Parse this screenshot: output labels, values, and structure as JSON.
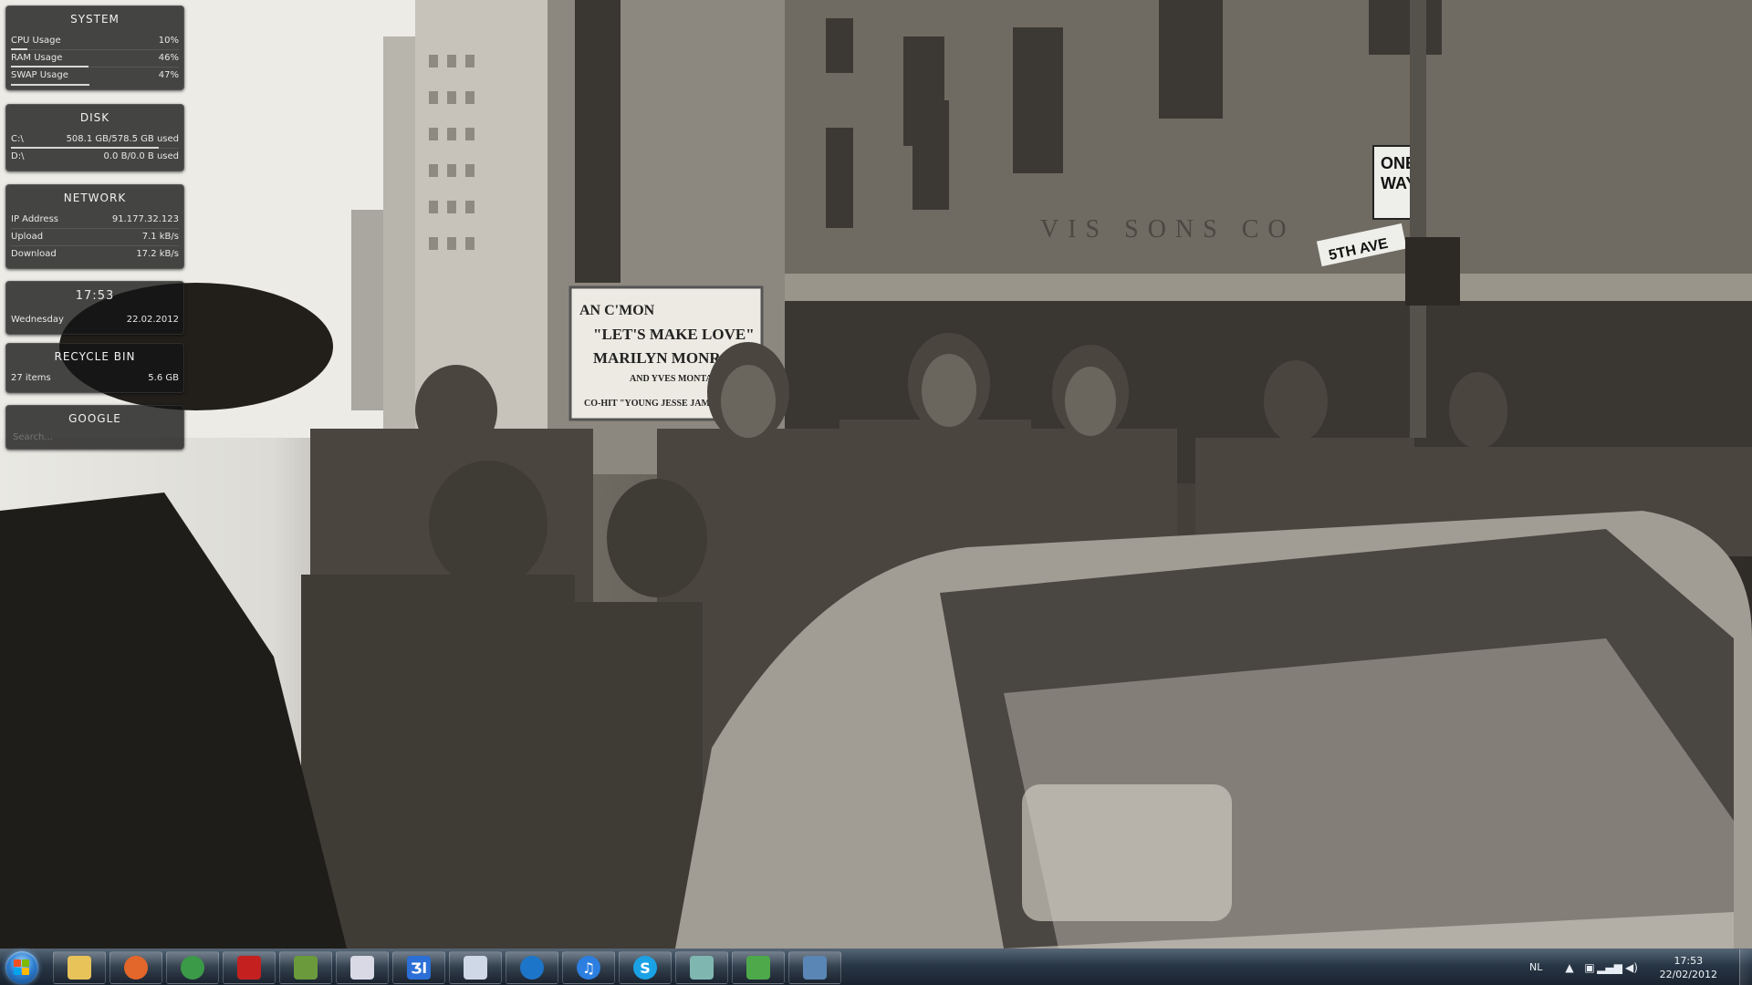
{
  "gadgets": {
    "system": {
      "title": "SYSTEM",
      "rows": [
        {
          "label": "CPU Usage",
          "value": "10%",
          "level": 0.1
        },
        {
          "label": "RAM Usage",
          "value": "46%",
          "level": 0.46
        },
        {
          "label": "SWAP Usage",
          "value": "47%",
          "level": 0.47
        }
      ]
    },
    "disk": {
      "title": "DISK",
      "rows": [
        {
          "label": "C:\\",
          "value": "508.1 GB/578.5 GB used",
          "level": 0.88
        },
        {
          "label": "D:\\",
          "value": "0.0 B/0.0 B used",
          "level": 0.0
        }
      ]
    },
    "network": {
      "title": "NETWORK",
      "rows": [
        {
          "label": "IP Address",
          "value": "91.177.32.123"
        },
        {
          "label": "Upload",
          "value": "7.1 kB/s"
        },
        {
          "label": "Download",
          "value": "17.2 kB/s"
        }
      ]
    },
    "clock": {
      "time": "17:53",
      "day": "Wednesday",
      "date": "22.02.2012"
    },
    "recycle": {
      "title": "RECYCLE BIN",
      "items": "27 items",
      "size": "5.6 GB"
    },
    "google": {
      "title": "GOOGLE",
      "placeholder": "Search..."
    }
  },
  "wallpaper": {
    "marquee_lines": [
      "AN C'MON",
      "\"LET'S MAKE LOVE\"",
      "MARILYN MONROE",
      "AND YVES MONTAND",
      "CO-HIT \"YOUNG JESSE JAMES\""
    ],
    "sign_one_way": [
      "ONE",
      "WAY"
    ],
    "sign_street": "5TH AVE",
    "facade_text": "VIS SONS CO"
  },
  "taskbar": {
    "apps": [
      {
        "name": "windows-explorer",
        "icon": "folder-icon",
        "glyph": "",
        "color": "#e8c35a"
      },
      {
        "name": "firefox",
        "icon": "firefox-icon",
        "glyph": "",
        "color": "#e3662a"
      },
      {
        "name": "chrome",
        "icon": "chrome-icon",
        "glyph": "",
        "color": "#3b9a47"
      },
      {
        "name": "app-red-black",
        "icon": "red-app-icon",
        "glyph": "",
        "color": "#c42020"
      },
      {
        "name": "minecraft",
        "icon": "minecraft-block-icon",
        "glyph": "",
        "color": "#6a9a3c"
      },
      {
        "name": "notepad-app",
        "icon": "document-chart-icon",
        "glyph": "",
        "color": "#d9d9e6"
      },
      {
        "name": "blue-app",
        "icon": "blue-app-icon",
        "glyph": "Ʒl",
        "color": "#2c6fd6"
      },
      {
        "name": "paint-app",
        "icon": "picture-icon",
        "glyph": "",
        "color": "#cfd8e6"
      },
      {
        "name": "teamviewer",
        "icon": "teamviewer-icon",
        "glyph": "",
        "color": "#1d75c9"
      },
      {
        "name": "itunes",
        "icon": "itunes-icon",
        "glyph": "♫",
        "color": "#2c7fe0"
      },
      {
        "name": "skype",
        "icon": "skype-icon",
        "glyph": "S",
        "color": "#1ba2e6"
      },
      {
        "name": "green-app",
        "icon": "page-icon",
        "glyph": "",
        "color": "#7fb7b0"
      },
      {
        "name": "messenger",
        "icon": "people-icon",
        "glyph": "",
        "color": "#4ea94a"
      },
      {
        "name": "photo-viewer",
        "icon": "photo-viewer-icon",
        "glyph": "",
        "color": "#5a86b5"
      }
    ],
    "tray": {
      "language": "NL",
      "time": "17:53",
      "date": "22/02/2012"
    }
  }
}
